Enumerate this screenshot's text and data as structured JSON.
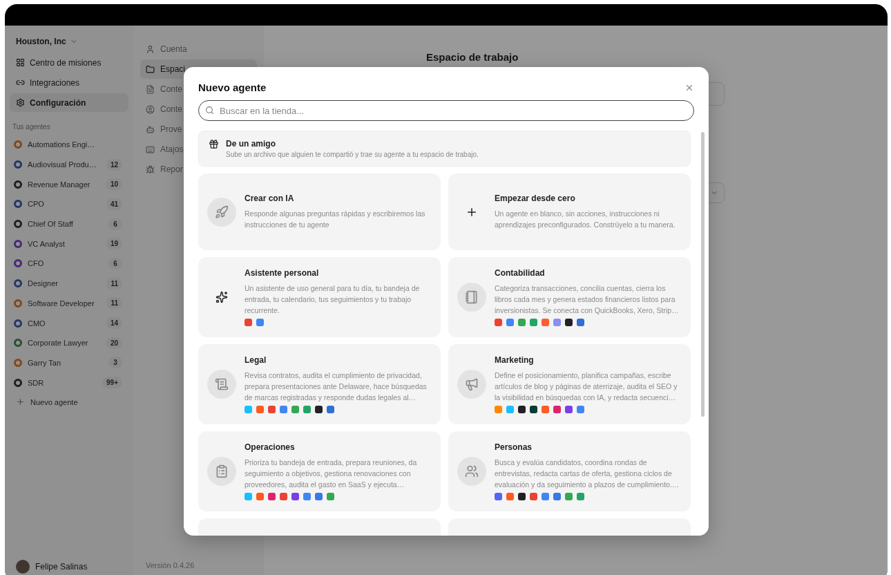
{
  "sidebar": {
    "workspace": "Houston, Inc",
    "nav": [
      {
        "label": "Centro de misiones",
        "selected": false
      },
      {
        "label": "Integraciones",
        "selected": false
      },
      {
        "label": "Configuración",
        "selected": true
      }
    ],
    "section_label": "Tus agentes",
    "agents": [
      {
        "name": "Automations Engi…",
        "color": "#82471a"
      },
      {
        "name": "Audiovisual Produ…",
        "count": "12",
        "color": "#233767"
      },
      {
        "name": "Revenue Manager",
        "count": "10",
        "color": "#1f1f1f"
      },
      {
        "name": "CPO",
        "count": "41",
        "color": "#233767"
      },
      {
        "name": "Chief Of Staff",
        "count": "6",
        "color": "#1f1f1f"
      },
      {
        "name": "VC Analyst",
        "count": "19",
        "color": "#49267d"
      },
      {
        "name": "CFO",
        "count": "6",
        "color": "#49267d"
      },
      {
        "name": "Designer",
        "count": "11",
        "color": "#233767"
      },
      {
        "name": "Software Developer",
        "count": "11",
        "color": "#82471a"
      },
      {
        "name": "CMO",
        "count": "14",
        "color": "#233767"
      },
      {
        "name": "Corporate Lawyer",
        "count": "20",
        "color": "#23532c"
      },
      {
        "name": "Garry Tan",
        "count": "3",
        "color": "#82471a"
      },
      {
        "name": "SDR",
        "count": "99+",
        "color": "#1f1f1f"
      }
    ],
    "new_agent": "Nuevo agente",
    "user": "Felipe Salinas"
  },
  "settings_nav": {
    "items": [
      {
        "label": "Cuenta",
        "selected": false
      },
      {
        "label": "Espaci",
        "selected": true
      },
      {
        "label": "Conte",
        "selected": false
      },
      {
        "label": "Conte",
        "selected": false
      },
      {
        "label": "Prove",
        "selected": false
      },
      {
        "label": "Atajos",
        "selected": false
      },
      {
        "label": "Repor",
        "selected": false
      }
    ],
    "version": "Versión 0.4.26"
  },
  "main": {
    "title": "Espacio de trabajo"
  },
  "modal": {
    "title": "Nuevo agente",
    "search": {
      "placeholder": "Buscar en la tienda..."
    },
    "friend": {
      "title": "De un amigo",
      "description": "Sube un archivo que alguien te compartió y trae su agente a tu espacio de trabajo."
    },
    "cards": [
      {
        "kind": "action",
        "title": "Crear con IA",
        "description": "Responde algunas preguntas rápidas y escribiremos las instrucciones de tu agente"
      },
      {
        "kind": "action",
        "title": "Empezar desde cero",
        "description": "Un agente en blanco, sin acciones, instrucciones ni aprendizajes preconfigurados. Constrúyelo a tu manera."
      },
      {
        "kind": "template",
        "title": "Asistente personal",
        "description": "Un asistente de uso general para tu día, tu bandeja de entrada, tu calendario, tus seguimientos y tu trabajo recurrente.",
        "apps": [
          {
            "color": "#ea4335"
          },
          {
            "color": "#4285f4"
          }
        ]
      },
      {
        "kind": "template",
        "title": "Contabilidad",
        "description": "Categoriza transacciones, concilia cuentas, cierra los libros cada mes y genera estados financieros listos para inversionistas. Se conecta con QuickBooks, Xero, Strip…",
        "apps": [
          {
            "color": "#ea4335"
          },
          {
            "color": "#4285f4"
          },
          {
            "color": "#34a853"
          },
          {
            "color": "#23a566"
          },
          {
            "color": "#ff5c35"
          },
          {
            "color": "#8b8ff0"
          },
          {
            "color": "#222222"
          },
          {
            "color": "#2f6fd6"
          }
        ]
      },
      {
        "kind": "template",
        "title": "Legal",
        "description": "Revisa contratos, audita el cumplimiento de privacidad, prepara presentaciones ante Delaware, hace búsquedas de marcas registradas y responde dudas legales al…",
        "apps": [
          {
            "color": "#18bfff"
          },
          {
            "color": "#ff5a1f"
          },
          {
            "color": "#ea4335"
          },
          {
            "color": "#4285f4"
          },
          {
            "color": "#34a853"
          },
          {
            "color": "#23a566"
          },
          {
            "color": "#222222"
          },
          {
            "color": "#2f6fd6"
          }
        ]
      },
      {
        "kind": "template",
        "title": "Marketing",
        "description": "Define el posicionamiento, planifica campañas, escribe artículos de blog y páginas de aterrizaje, audita el SEO y la visibilidad en búsquedas con IA, y redacta secuenci…",
        "apps": [
          {
            "color": "#ff8a00"
          },
          {
            "color": "#18bfff"
          },
          {
            "color": "#222222"
          },
          {
            "color": "#0b3b33"
          },
          {
            "color": "#ff5a1f"
          },
          {
            "color": "#e0246b"
          },
          {
            "color": "#7b3fe4"
          },
          {
            "color": "#4285f4"
          }
        ]
      },
      {
        "kind": "template",
        "title": "Operaciones",
        "description": "Prioriza tu bandeja de entrada, prepara reuniones, da seguimiento a objetivos, gestiona renovaciones con proveedores, audita el gasto en SaaS y ejecuta…",
        "apps": [
          {
            "color": "#18bfff"
          },
          {
            "color": "#ff5a1f"
          },
          {
            "color": "#e0246b"
          },
          {
            "color": "#ea4335"
          },
          {
            "color": "#7b3fe4"
          },
          {
            "color": "#4285f4"
          },
          {
            "color": "#3b78e7"
          },
          {
            "color": "#34a853"
          }
        ]
      },
      {
        "kind": "template",
        "title": "Personas",
        "description": "Busca y evalúa candidatos, coordina rondas de entrevistas, redacta cartas de oferta, gestiona ciclos de evaluación y da seguimiento a plazos de cumplimiento.…",
        "apps": [
          {
            "color": "#5865f2"
          },
          {
            "color": "#ff5a1f"
          },
          {
            "color": "#222222"
          },
          {
            "color": "#ea4335"
          },
          {
            "color": "#4285f4"
          },
          {
            "color": "#3b78e7"
          },
          {
            "color": "#34a853"
          },
          {
            "color": "#23a566"
          }
        ]
      },
      {
        "kind": "hidden"
      },
      {
        "kind": "hidden"
      }
    ]
  }
}
